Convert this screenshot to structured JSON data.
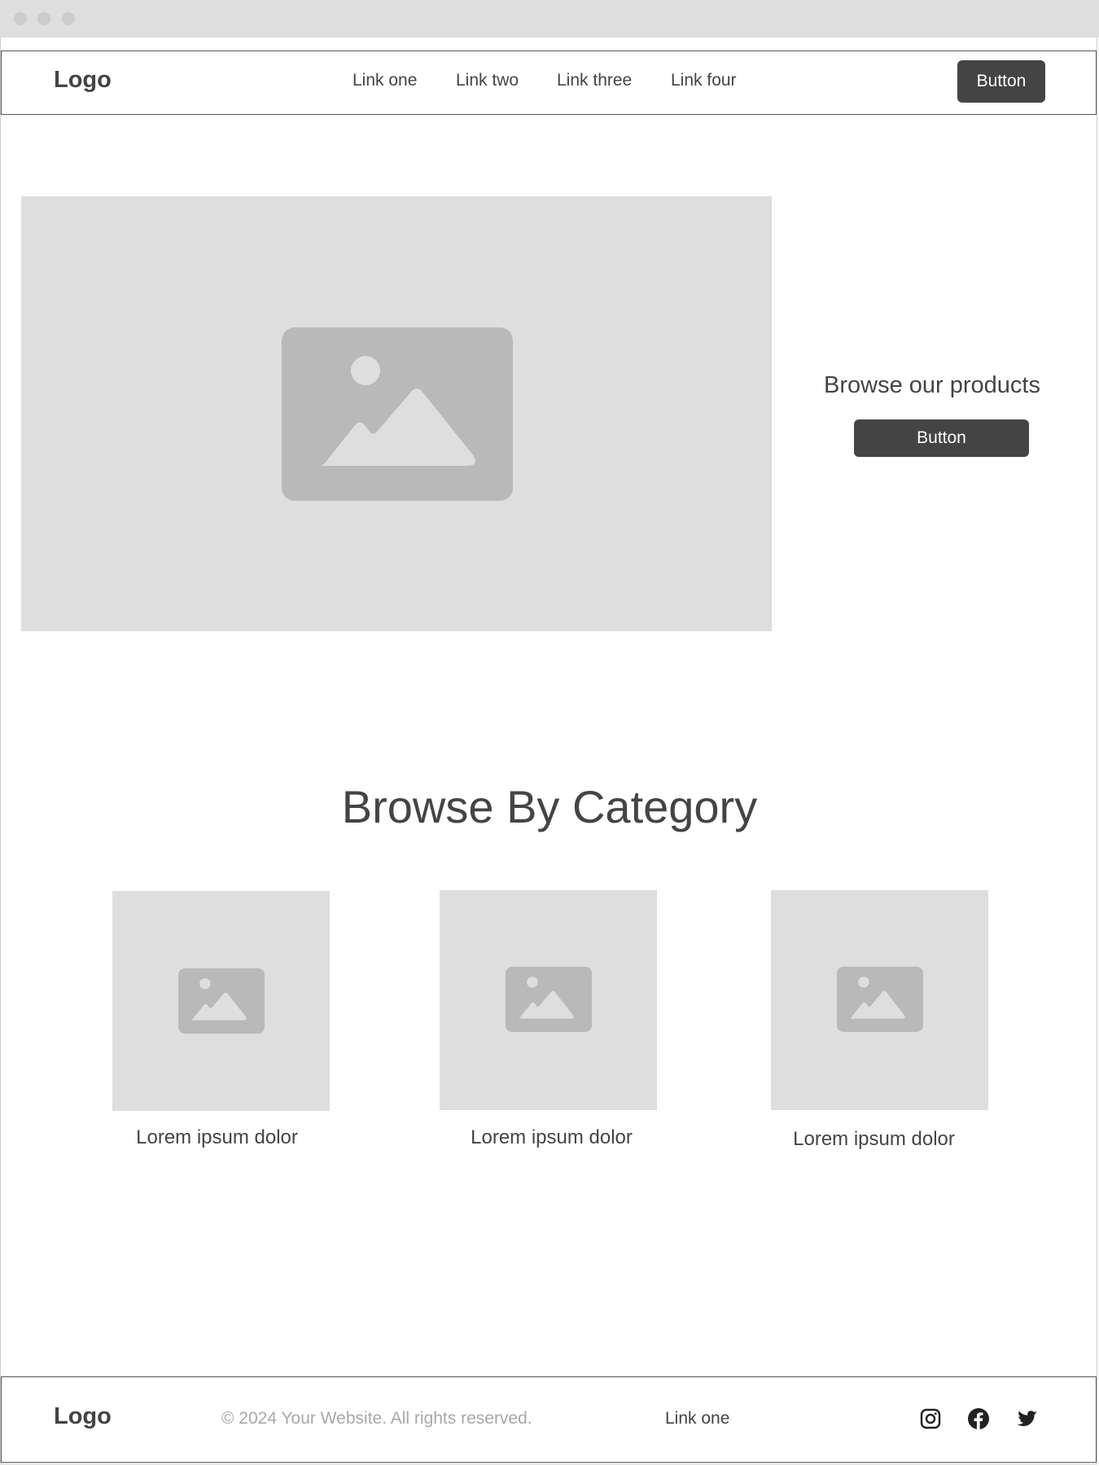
{
  "header": {
    "logo": "Logo",
    "nav": [
      "Link one",
      "Link two",
      "Link three",
      "Link four"
    ],
    "button_label": "Button"
  },
  "hero": {
    "image": "image-placeholder-icon",
    "title": "Browse our products",
    "button_label": "Button"
  },
  "categories": {
    "title": "Browse By Category",
    "items": [
      {
        "caption": "Lorem ipsum dolor",
        "image": "image-placeholder-icon"
      },
      {
        "caption": "Lorem ipsum dolor",
        "image": "image-placeholder-icon"
      },
      {
        "caption": "Lorem ipsum dolor",
        "image": "image-placeholder-icon"
      }
    ]
  },
  "footer": {
    "logo": "Logo",
    "copyright": "© 2024 Your Website. All rights reserved.",
    "link": "Link one",
    "social": [
      "instagram-icon",
      "facebook-icon",
      "twitter-icon"
    ]
  },
  "colors": {
    "dark": "#444444",
    "placeholder": "#dedede",
    "placeholder_icon": "#b9b9b9",
    "muted_text": "#a8a8a8"
  }
}
